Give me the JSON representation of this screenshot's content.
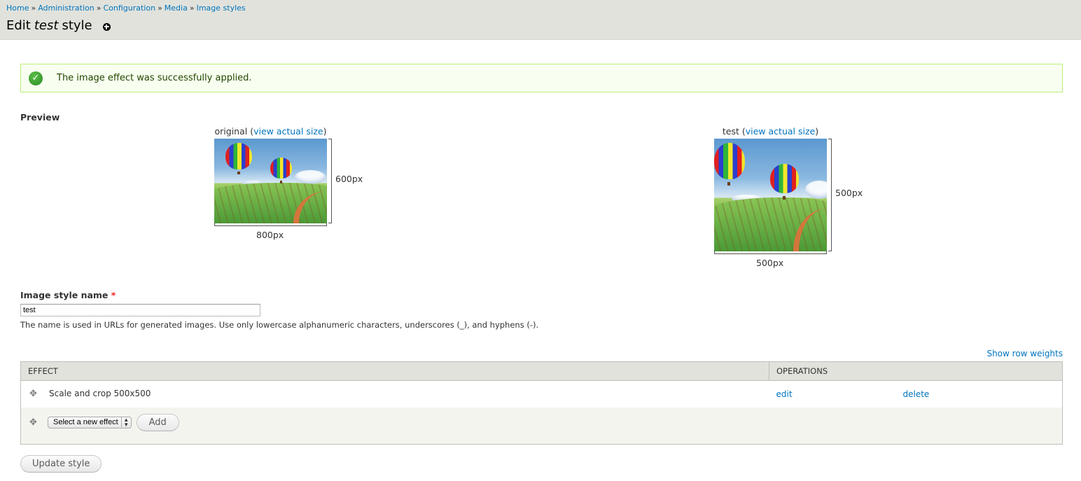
{
  "breadcrumb": [
    {
      "label": "Home"
    },
    {
      "label": "Administration"
    },
    {
      "label": "Configuration"
    },
    {
      "label": "Media"
    },
    {
      "label": "Image styles"
    }
  ],
  "breadcrumb_separator": "»",
  "title": {
    "prefix": "Edit",
    "name": "test",
    "suffix": "style"
  },
  "message": {
    "text": "The image effect was successfully applied.",
    "status": "status"
  },
  "preview": {
    "label": "Preview",
    "original": {
      "name": "original",
      "link": "view actual size",
      "width_label": "800px",
      "height_label": "600px"
    },
    "derivative": {
      "name": "test",
      "link": "view actual size",
      "width_label": "500px",
      "height_label": "500px"
    }
  },
  "form": {
    "name_label": "Image style name",
    "required_marker": "*",
    "name_value": "test",
    "description": "The name is used in URLs for generated images. Use only lowercase alphanumeric characters, underscores (_), and hyphens (-)."
  },
  "table": {
    "show_weights": "Show row weights",
    "headers": {
      "effect": "EFFECT",
      "operations": "OPERATIONS"
    },
    "rows": [
      {
        "effect": "Scale and crop 500x500",
        "edit": "edit",
        "delete": "delete"
      }
    ],
    "new_effect": {
      "select_value": "Select a new effect",
      "add_label": "Add"
    }
  },
  "actions": {
    "update_label": "Update style"
  },
  "colors": {
    "link": "#0074bd",
    "header_bg": "#e1e2dc",
    "message_border": "#bbee77",
    "message_bg": "#f8fff0"
  }
}
